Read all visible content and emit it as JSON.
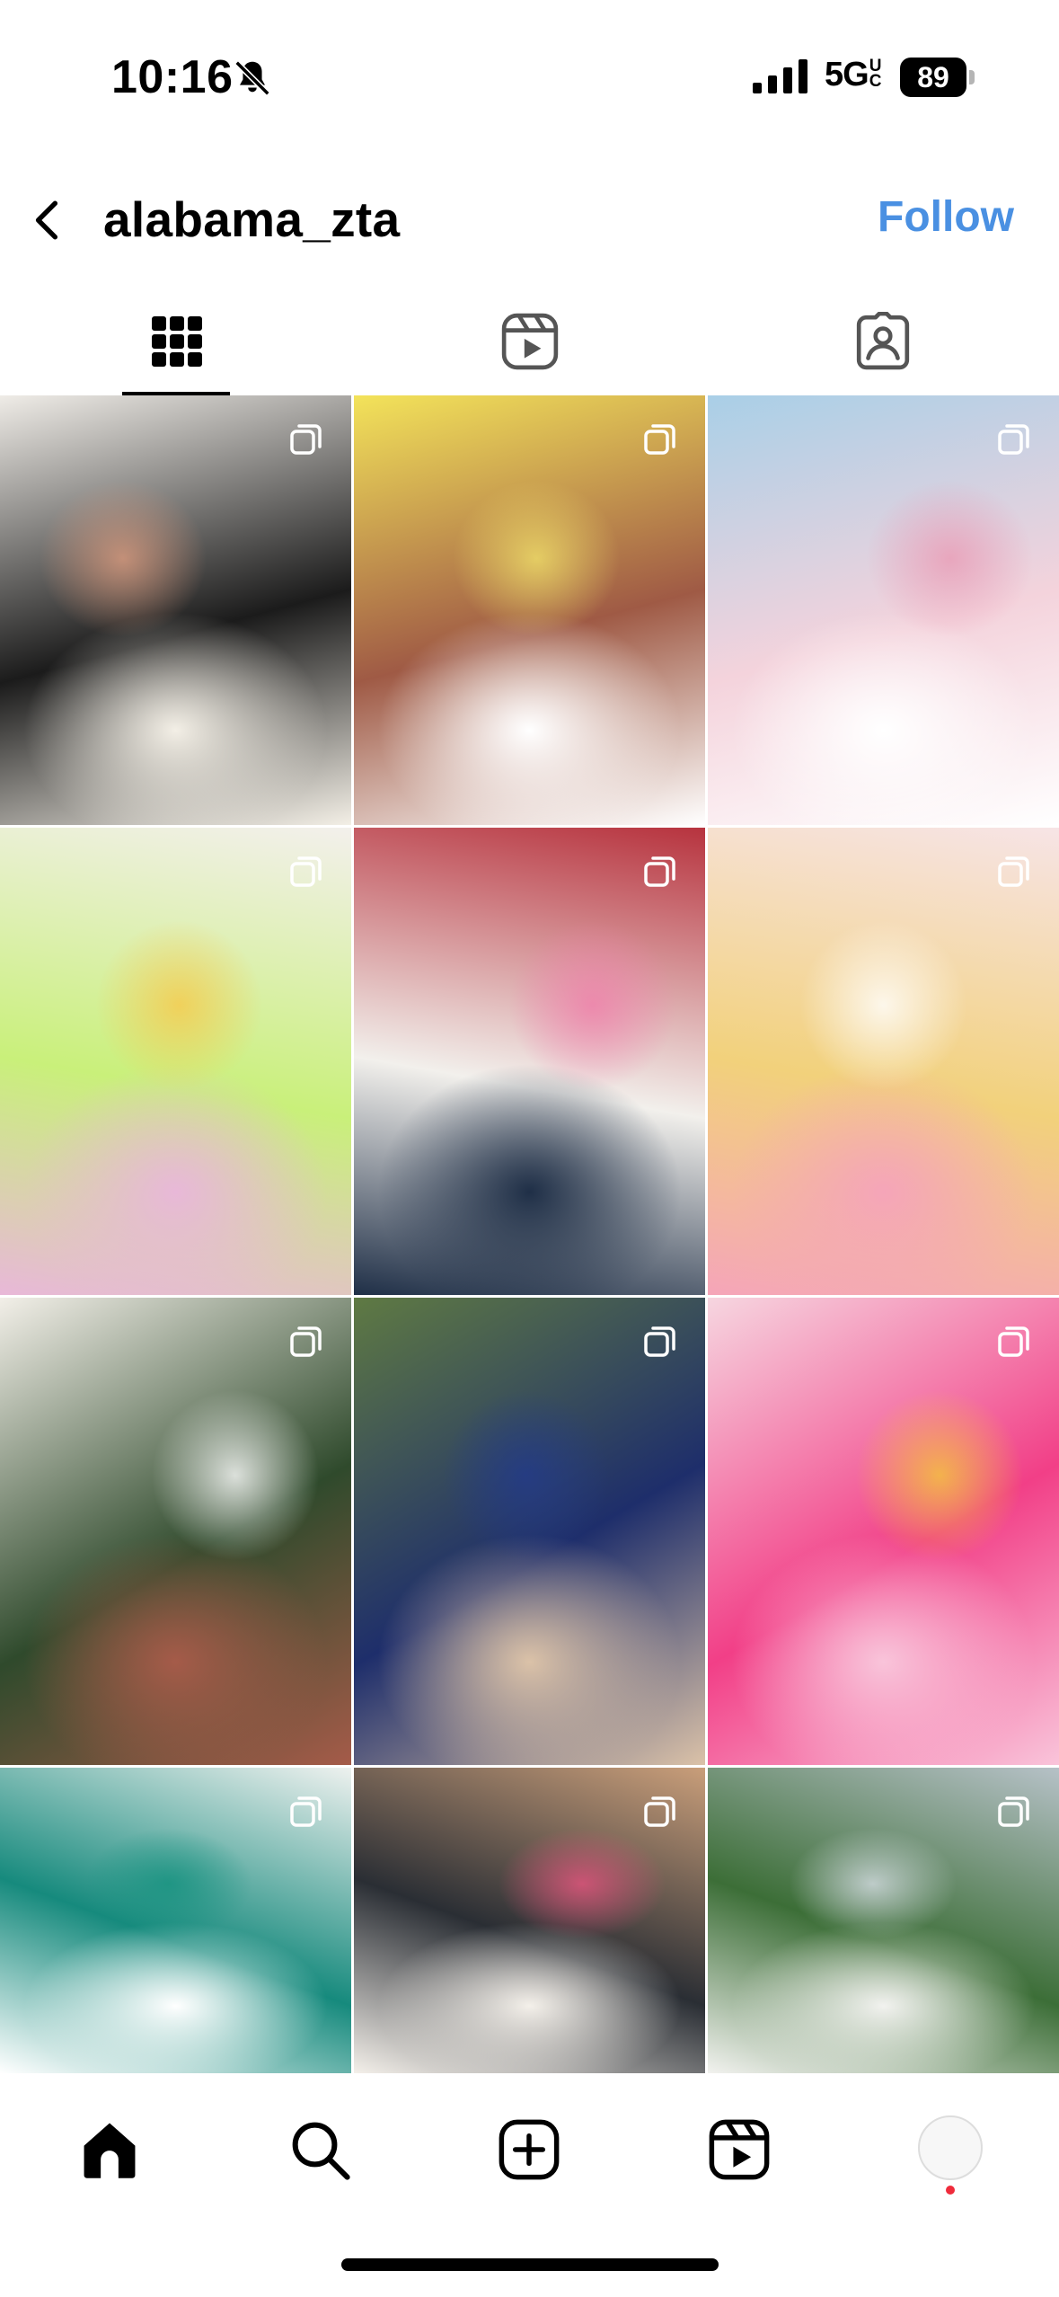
{
  "status_bar": {
    "time": "10:16",
    "network": "5G",
    "network_suffix": "UC",
    "battery": "89",
    "icons": [
      "bell-slash-icon",
      "signal-bars-icon",
      "battery-icon"
    ]
  },
  "header": {
    "username": "alabama_zta",
    "follow_label": "Follow",
    "icons": [
      "chevron-left-icon"
    ]
  },
  "tabs": [
    {
      "name": "posts-grid",
      "icon": "grid-icon",
      "selected": true
    },
    {
      "name": "reels",
      "icon": "reels-icon",
      "selected": false
    },
    {
      "name": "tagged",
      "icon": "tagged-person-icon",
      "selected": false
    }
  ],
  "grid": {
    "multi_post_icon": "multi-post-icon",
    "posts": [
      {
        "palette": [
          "#efece7",
          "#1b1b1b",
          "#f3efe6"
        ],
        "accent": "#dc9c7f"
      },
      {
        "palette": [
          "#f3e35a",
          "#9f5a45",
          "#ffffff"
        ],
        "accent": "#f0e06a"
      },
      {
        "palette": [
          "#a9cfe7",
          "#f4d3dc",
          "#ffffff"
        ],
        "accent": "#e99bb5"
      },
      {
        "palette": [
          "#f3f0ec",
          "#c9f07a",
          "#e8b8d8"
        ],
        "accent": "#f7c94b"
      },
      {
        "palette": [
          "#b7333e",
          "#f2f0ec",
          "#1f2f47"
        ],
        "accent": "#f07fab"
      },
      {
        "palette": [
          "#f7e4e6",
          "#f2d17b",
          "#f5a5b9"
        ],
        "accent": "#ffffff"
      },
      {
        "palette": [
          "#f2efe8",
          "#2f4a2c",
          "#a55b49"
        ],
        "accent": "#ffffff"
      },
      {
        "palette": [
          "#5f7a43",
          "#1e2e6b",
          "#dbc2a8"
        ],
        "accent": "#233b8a"
      },
      {
        "palette": [
          "#f6d6e0",
          "#f23f87",
          "#f9c4da"
        ],
        "accent": "#f3c93b"
      },
      {
        "palette": [
          "#eef1ef",
          "#168a7d",
          "#ffffff"
        ],
        "accent": "#15927f"
      },
      {
        "palette": [
          "#c99e7a",
          "#2a2e34",
          "#f4f0ea"
        ],
        "accent": "#e7547f"
      },
      {
        "palette": [
          "#b6c1c7",
          "#3c6e37",
          "#f2f2ef"
        ],
        "accent": "#d7dee5"
      }
    ]
  },
  "bottom_nav": {
    "items": [
      "home-icon",
      "search-icon",
      "create-icon",
      "reels-icon",
      "profile-avatar"
    ],
    "notification_color": "#ef2b3b"
  }
}
